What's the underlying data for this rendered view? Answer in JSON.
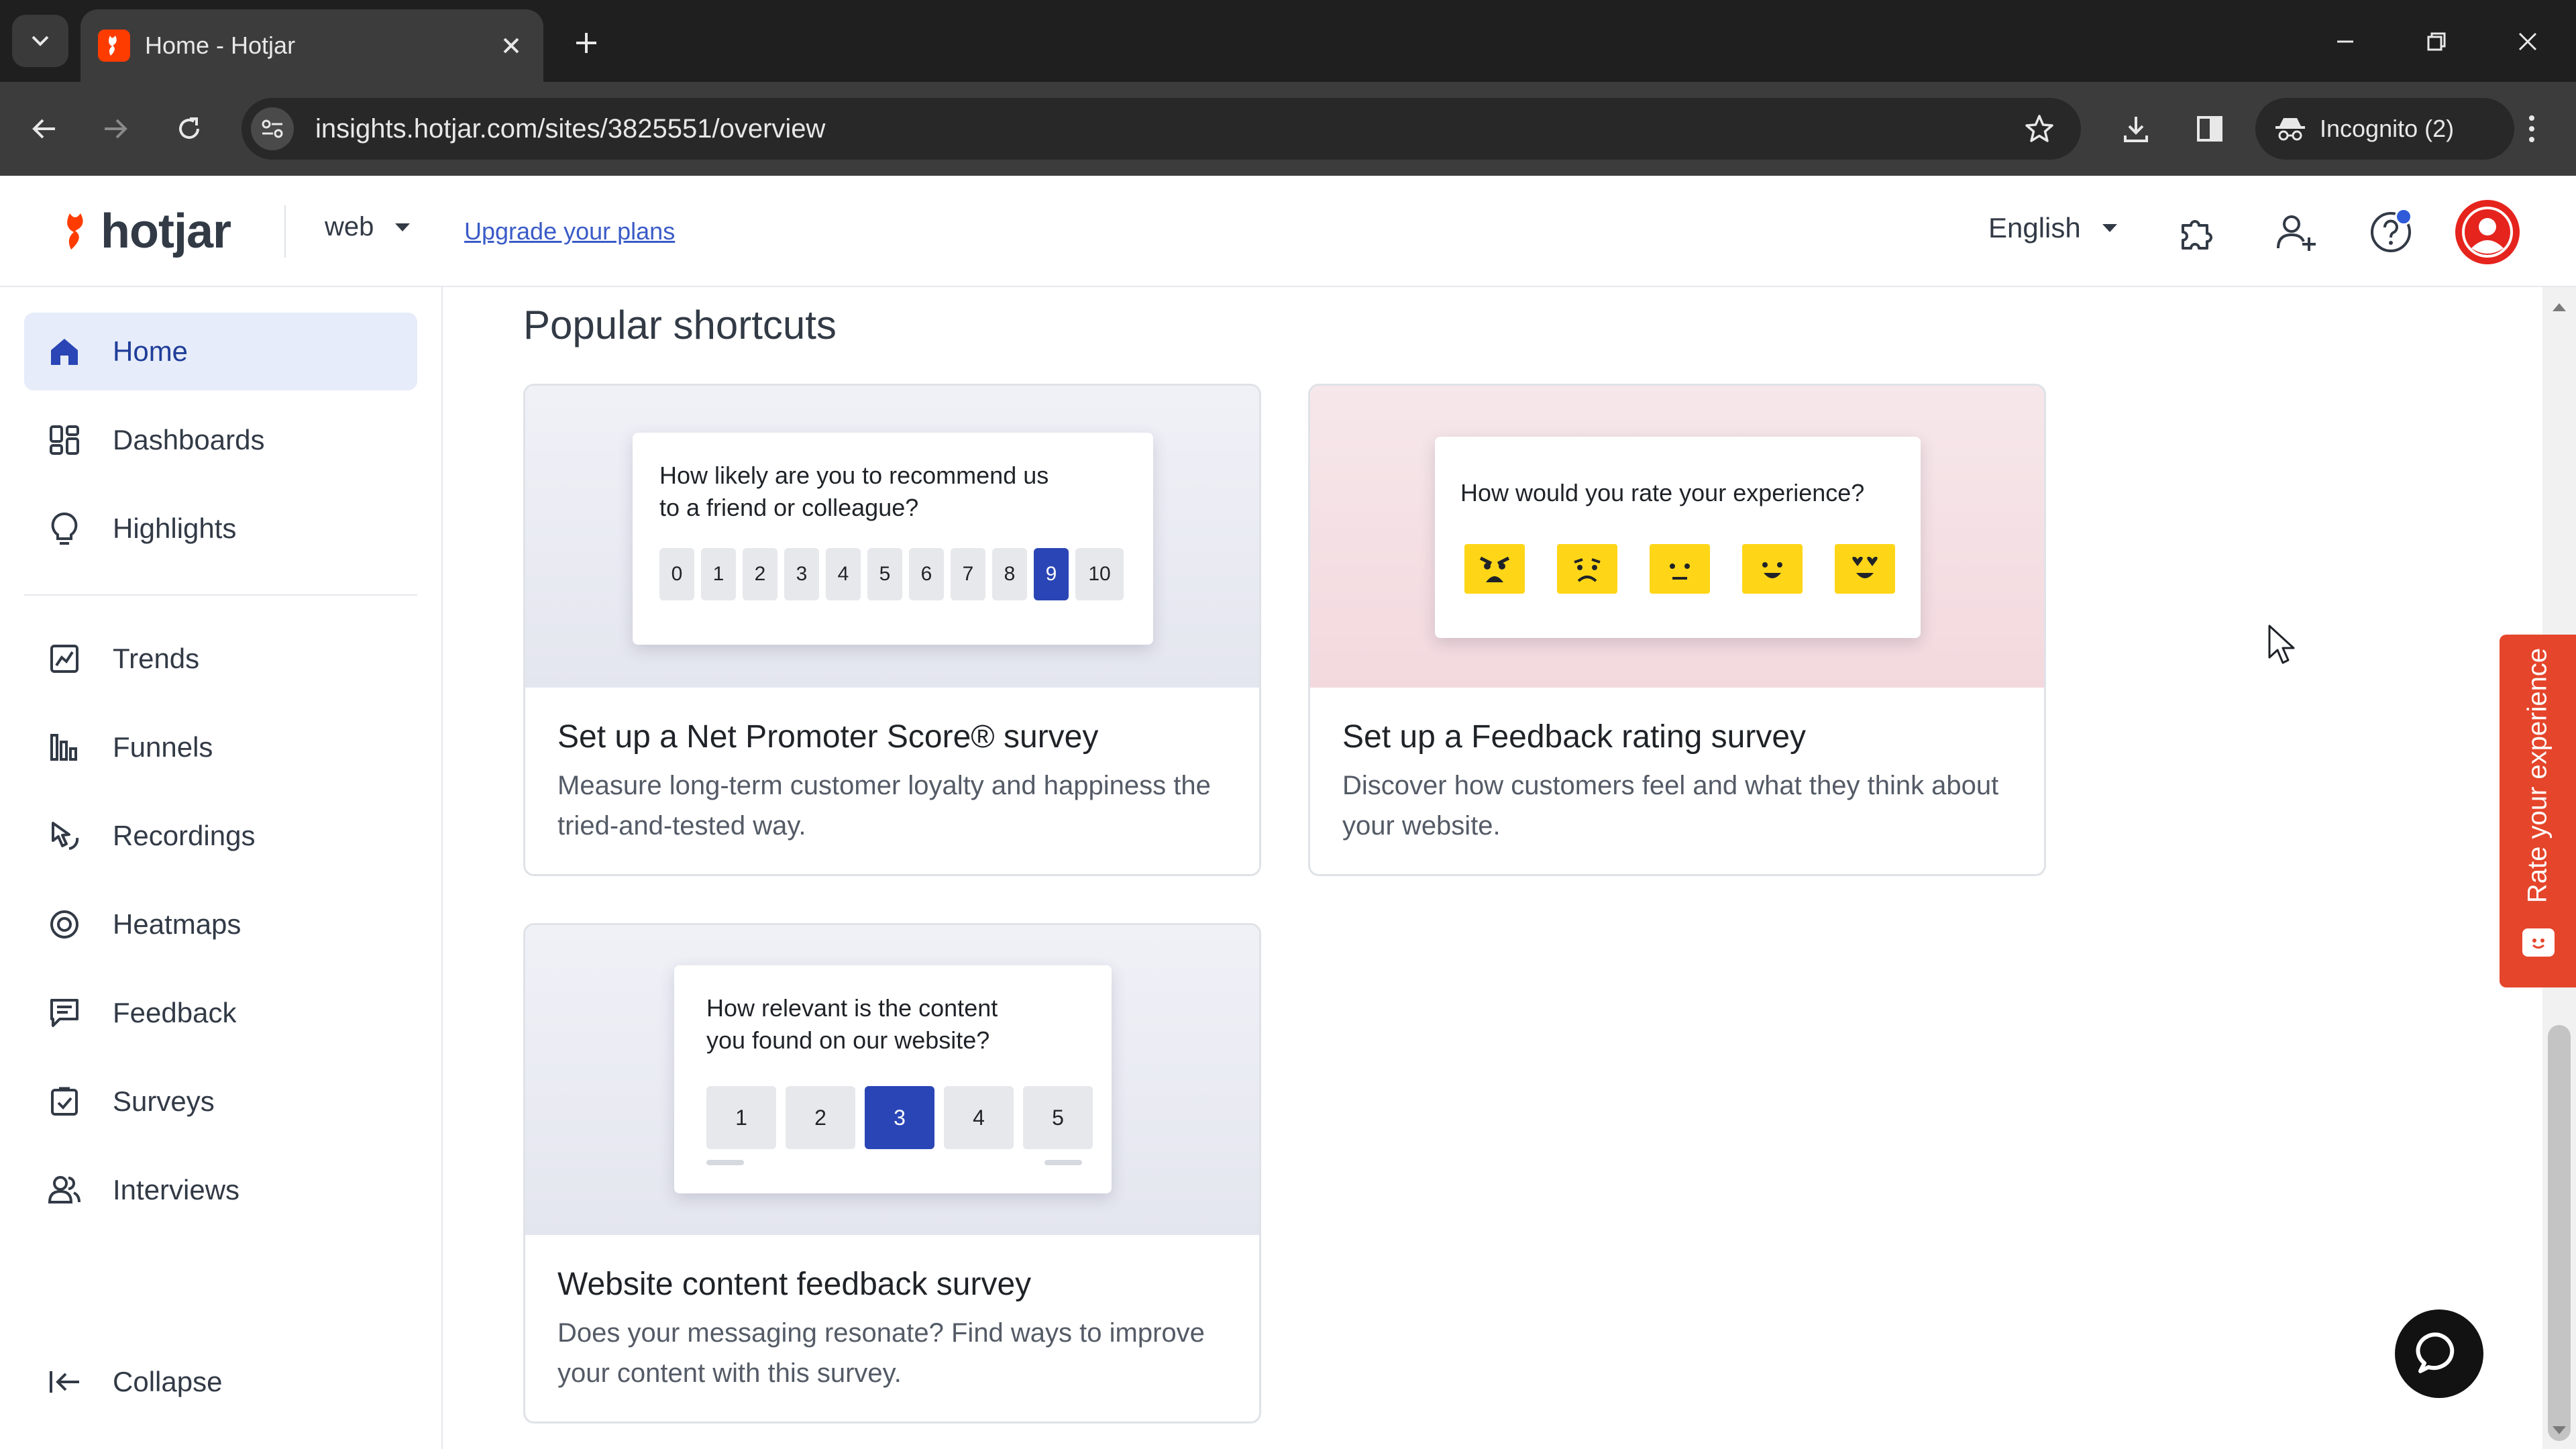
{
  "browser": {
    "tab_title": "Home - Hotjar",
    "url": "insights.hotjar.com/sites/3825551/overview",
    "incognito_label": "Incognito (2)"
  },
  "header": {
    "logo_text": "hotjar",
    "site_name": "web",
    "upgrade_link": "Upgrade your plans",
    "language": "English"
  },
  "sidebar": {
    "items": [
      {
        "label": "Home",
        "icon": "home-icon"
      },
      {
        "label": "Dashboards",
        "icon": "dashboards-icon"
      },
      {
        "label": "Highlights",
        "icon": "lightbulb-icon"
      },
      {
        "label": "Trends",
        "icon": "trends-icon"
      },
      {
        "label": "Funnels",
        "icon": "funnels-icon"
      },
      {
        "label": "Recordings",
        "icon": "recordings-icon"
      },
      {
        "label": "Heatmaps",
        "icon": "heatmaps-icon"
      },
      {
        "label": "Feedback",
        "icon": "feedback-icon"
      },
      {
        "label": "Surveys",
        "icon": "surveys-icon"
      },
      {
        "label": "Interviews",
        "icon": "interviews-icon"
      }
    ],
    "collapse_label": "Collapse"
  },
  "main": {
    "section_title": "Popular shortcuts",
    "cards": [
      {
        "title": "Set up a Net Promoter Score® survey",
        "description": "Measure long-term customer loyalty and happiness the tried-and-tested way.",
        "preview_question_line1": "How likely are you to recommend us",
        "preview_question_line2": "to a friend or colleague?",
        "scale": [
          "0",
          "1",
          "2",
          "3",
          "4",
          "5",
          "6",
          "7",
          "8",
          "9",
          "10"
        ],
        "selected": "9"
      },
      {
        "title": "Set up a Feedback rating survey",
        "description": "Discover how customers feel and what they think about your website.",
        "preview_question": "How would you rate your experience?",
        "emoji_icons": [
          "angry-face-icon",
          "sad-face-icon",
          "neutral-face-icon",
          "happy-face-icon",
          "love-face-icon"
        ]
      },
      {
        "title": "Website content feedback survey",
        "description": "Does your messaging resonate? Find ways to improve your content with this survey.",
        "preview_question_line1": "How relevant is the content",
        "preview_question_line2": "you found on our website?",
        "scale": [
          "1",
          "2",
          "3",
          "4",
          "5"
        ],
        "selected": "3"
      }
    ]
  },
  "widget": {
    "rate_label": "Rate your experience"
  },
  "colors": {
    "brand_orange": "#ff3c00",
    "accent_blue": "#2a45b5",
    "active_nav_bg": "#e6ecf9",
    "emoji_yellow": "#ffd617",
    "rate_tab": "#e5452b"
  }
}
